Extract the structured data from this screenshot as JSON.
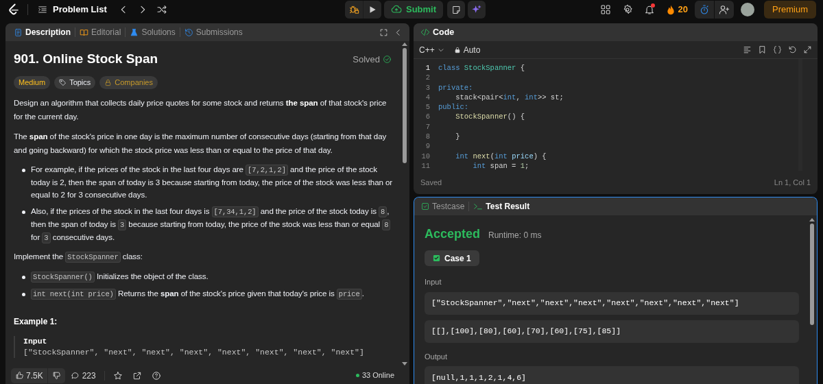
{
  "top_bar": {
    "problem_list": "Problem List",
    "submit": "Submit",
    "notification_dot": true,
    "streak": "20",
    "premium": "Premium"
  },
  "description_panel": {
    "tabs": [
      {
        "label": "Description",
        "kind": "description",
        "selected": true
      },
      {
        "label": "Editorial",
        "kind": "editorial",
        "selected": false
      },
      {
        "label": "Solutions",
        "kind": "solutions",
        "selected": false
      },
      {
        "label": "Submissions",
        "kind": "submissions",
        "selected": false
      }
    ],
    "title": "901. Online Stock Span",
    "status": "Solved",
    "tags": [
      {
        "label": "Medium",
        "kind": "difficulty"
      },
      {
        "label": "Topics",
        "kind": "topics"
      },
      {
        "label": "Companies",
        "kind": "companies"
      }
    ],
    "body": [
      {
        "kind": "paragraph",
        "segments": [
          {
            "kind": "text",
            "text": "Design an algorithm that collects daily price quotes for some stock and returns **the span** of that stock's price for the current day."
          }
        ]
      },
      {
        "kind": "paragraph",
        "segments": [
          {
            "kind": "text",
            "text": "The **span** of the stock's price in one day is the maximum number of consecutive days (starting from that day and going backward) for which the stock price was less than or equal to the price of that day."
          }
        ]
      },
      {
        "kind": "bullets",
        "items": [
          [
            {
              "kind": "text",
              "text": "For example, if the prices of the stock in the last four days are "
            },
            {
              "kind": "code",
              "text": "[7,2,1,2]"
            },
            {
              "kind": "text",
              "text": " and the price of the stock today is 2, then the span of today is 3 because starting from today, the price of the stock was less than or equal to 2 for 3 consecutive days."
            }
          ],
          [
            {
              "kind": "text",
              "text": "Also, if the prices of the stock in the last four days is "
            },
            {
              "kind": "code",
              "text": "[7,34,1,2]"
            },
            {
              "kind": "text",
              "text": " and the price of the stock today is "
            },
            {
              "kind": "code",
              "text": "8"
            },
            {
              "kind": "text",
              "text": ", then the span of today is "
            },
            {
              "kind": "code",
              "text": "3"
            },
            {
              "kind": "text",
              "text": " because starting from today, the price of the stock was less than or equal "
            },
            {
              "kind": "code",
              "text": "8"
            },
            {
              "kind": "text",
              "text": " for "
            },
            {
              "kind": "code",
              "text": "3"
            },
            {
              "kind": "text",
              "text": " consecutive days."
            }
          ]
        ]
      },
      {
        "kind": "paragraph",
        "segments": [
          {
            "kind": "text",
            "text": "Implement the "
          },
          {
            "kind": "code",
            "text": "StockSpanner"
          },
          {
            "kind": "text",
            "text": " class:"
          }
        ]
      },
      {
        "kind": "bullets",
        "items": [
          [
            {
              "kind": "code",
              "text": "StockSpanner()"
            },
            {
              "kind": "text",
              "text": " Initializes the object of the class."
            }
          ],
          [
            {
              "kind": "code",
              "text": "int next(int price)"
            },
            {
              "kind": "text",
              "text": " Returns the **span** of the stock's price given that today's price is "
            },
            {
              "kind": "code",
              "text": "price"
            },
            {
              "kind": "text",
              "text": "."
            }
          ]
        ]
      },
      {
        "kind": "heading",
        "text": "Example 1:"
      },
      {
        "kind": "example",
        "label": "Input",
        "lines": [
          "[\"StockSpanner\", \"next\", \"next\", \"next\", \"next\", \"next\", \"next\", \"next\"]"
        ]
      }
    ],
    "footer": {
      "likes": "7.5K",
      "comments": "223",
      "online": "33 Online"
    }
  },
  "code_panel": {
    "title": "Code",
    "language": "C++",
    "mode": "Auto",
    "lines": [
      {
        "number": "1",
        "current": true,
        "tokens": [
          {
            "kind": "keyword",
            "text": "class "
          },
          {
            "kind": "type",
            "text": "StockSpanner"
          },
          {
            "kind": "plain",
            "text": " {"
          }
        ]
      },
      {
        "number": "2",
        "current": false
      },
      {
        "number": "3",
        "current": false,
        "tokens": [
          {
            "kind": "keyword",
            "text": "private:"
          }
        ]
      },
      {
        "number": "4",
        "current": false,
        "tokens": [
          {
            "kind": "plain",
            "text": "    stack<pair<"
          },
          {
            "kind": "keyword",
            "text": "int"
          },
          {
            "kind": "plain",
            "text": ", "
          },
          {
            "kind": "keyword",
            "text": "int"
          },
          {
            "kind": "plain",
            "text": ">> st;"
          }
        ]
      },
      {
        "number": "5",
        "current": false,
        "tokens": [
          {
            "kind": "keyword",
            "text": "public:"
          }
        ]
      },
      {
        "number": "6",
        "current": false,
        "tokens": [
          {
            "kind": "function",
            "text": "    StockSpanner"
          },
          {
            "kind": "plain",
            "text": "() {"
          }
        ]
      },
      {
        "number": "7",
        "current": false
      },
      {
        "number": "8",
        "current": false,
        "tokens": [
          {
            "kind": "plain",
            "text": "    }"
          }
        ]
      },
      {
        "number": "9",
        "current": false
      },
      {
        "number": "10",
        "current": false,
        "tokens": [
          {
            "kind": "keyword",
            "text": "    int "
          },
          {
            "kind": "function",
            "text": "next"
          },
          {
            "kind": "plain",
            "text": "("
          },
          {
            "kind": "keyword",
            "text": "int "
          },
          {
            "kind": "variable",
            "text": "price"
          },
          {
            "kind": "plain",
            "text": ") {"
          }
        ]
      },
      {
        "number": "11",
        "current": false,
        "tokens": [
          {
            "kind": "keyword",
            "text": "        int"
          },
          {
            "kind": "plain",
            "text": " span = "
          },
          {
            "kind": "number",
            "text": "1"
          },
          {
            "kind": "plain",
            "text": ";"
          }
        ]
      }
    ],
    "save_status": "Saved",
    "cursor": "Ln 1, Col 1"
  },
  "result_panel": {
    "tabs": [
      {
        "label": "Testcase",
        "kind": "testcase",
        "selected": false
      },
      {
        "label": "Test Result",
        "kind": "result",
        "selected": true
      }
    ],
    "verdict": "Accepted",
    "runtime": "Runtime: 0 ms",
    "cases": [
      {
        "label": "Case 1",
        "selected": true,
        "passed": true
      }
    ],
    "input_label": "Input",
    "inputs": [
      "[\"StockSpanner\",\"next\",\"next\",\"next\",\"next\",\"next\",\"next\",\"next\"]",
      "[[],[100],[80],[60],[70],[60],[75],[85]]"
    ],
    "output_label": "Output",
    "output": "[null,1,1,1,2,1,4,6]"
  }
}
